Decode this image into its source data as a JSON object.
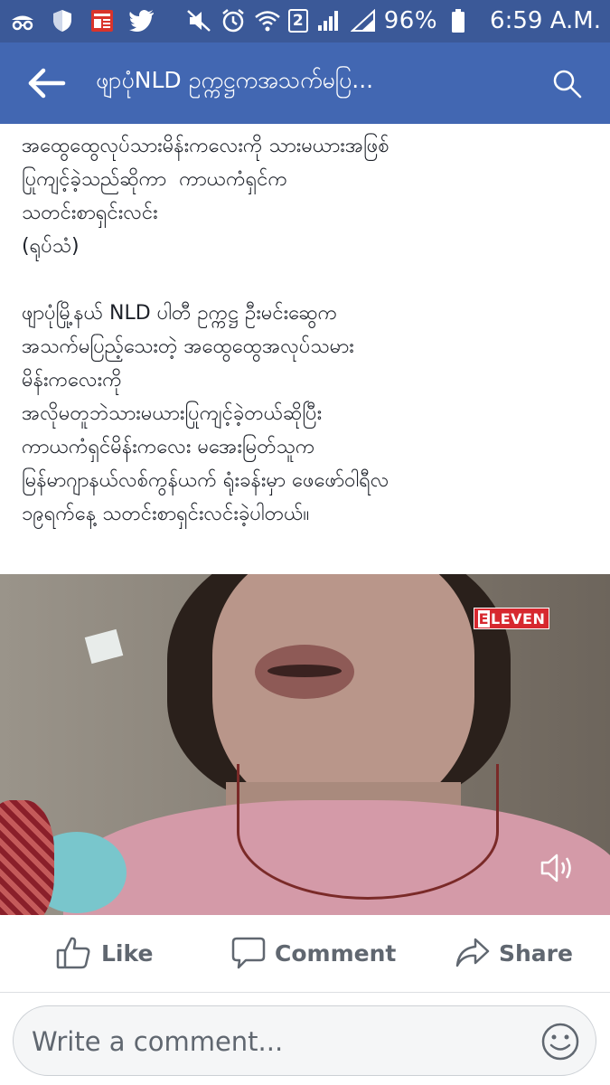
{
  "status_bar": {
    "left_icons": [
      "incognito-icon",
      "shield-icon",
      "news-app-icon",
      "twitter-icon"
    ],
    "right_icons": [
      "mute-icon",
      "alarm-icon",
      "wifi-icon",
      "sim-2-icon",
      "signal-icon"
    ],
    "sim_label": "2",
    "battery": "96%",
    "time": "6:59 A.M."
  },
  "app_bar": {
    "title": "ဖျာပုံNLD  ဥက္ကဋ္ဌကအသက်မပြ..."
  },
  "post": {
    "paragraph1": [
      "အထွေထွေလုပ်သားမိန်းကလေးကို သားမယားအဖြစ်",
      "ပြုကျင့်ခဲ့သည်ဆိုကာ  ကာယကံရှင်က",
      "သတင်းစာရှင်းလင်း",
      "(ရုပ်သံ)"
    ],
    "paragraph2": [
      "ဖျာပုံမြို့နယ် NLD ပါတီ ဥက္ကဋ္ဌ ဦးမင်းဆွေက",
      "အသက်မပြည့်သေးတဲ့ အထွေထွေအလုပ်သမား",
      "မိန်းကလေးကို",
      "အလိုမတူဘဲသားမယားပြုကျင့်ခဲ့တယ်ဆိုပြီး",
      "ကာယကံရှင်မိန်းကလေး မအေးမြတ်သူက",
      "မြန်မာဂျာနယ်လစ်ကွန်ယက် ရုံးခန်းမှာ ဖေဖော်ဝါရီလ",
      "၁၉ရက်နေ့ သတင်းစာရှင်းလင်းခဲ့ပါတယ်။"
    ]
  },
  "video": {
    "logo_first": "E",
    "logo_rest": "LEVEN"
  },
  "actions": {
    "like": "Like",
    "comment": "Comment",
    "share": "Share"
  },
  "comment_bar": {
    "placeholder": "Write a comment..."
  },
  "colors": {
    "status_bar": "#3b5998",
    "app_bar": "#4267b2",
    "action_text": "#606770"
  }
}
